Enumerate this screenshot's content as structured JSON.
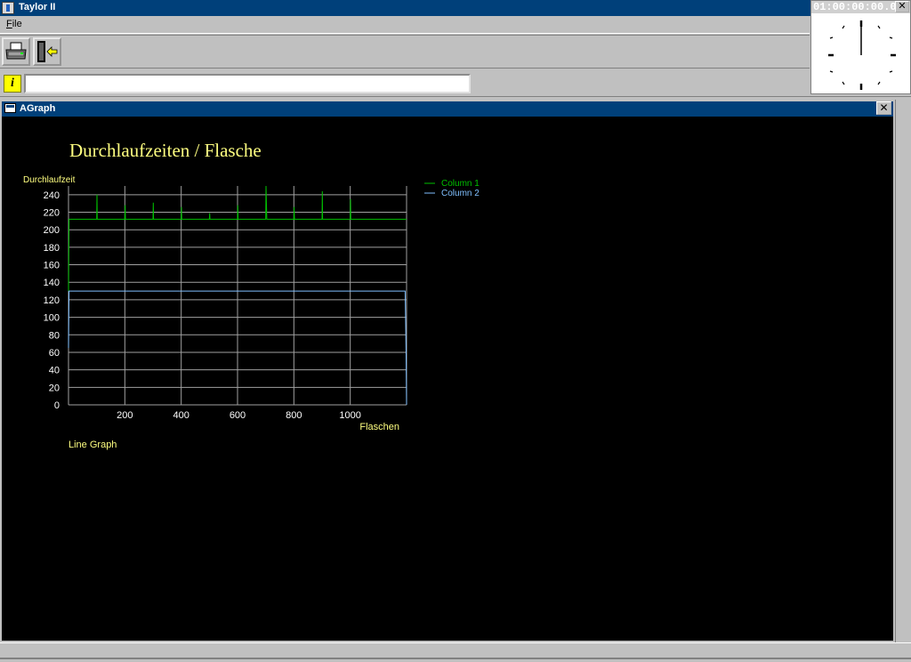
{
  "app": {
    "title": "Taylor II"
  },
  "menu": {
    "file_accel": "F",
    "file_rest": "ile"
  },
  "toolbar": {
    "print_icon": "printer-icon",
    "exit_icon": "exit-door-icon"
  },
  "infobar": {
    "icon": "info-icon",
    "icon_text": "i",
    "value": ""
  },
  "clock": {
    "time": "01:00:00:00.0",
    "close": "✕"
  },
  "window": {
    "title": "AGraph",
    "close": "✕"
  },
  "colors": {
    "titlebar": "#00407a",
    "series1": "#00c000",
    "series2": "#80c0ff",
    "chart_text": "#ffff80"
  },
  "chart_data": {
    "type": "line",
    "title": "Durchlaufzeiten / Flasche",
    "ylabel": "Durchlaufzeit",
    "xlabel": "Flaschen",
    "caption": "Line Graph",
    "xlim": [
      0,
      1200
    ],
    "ylim": [
      0,
      250
    ],
    "xticks": [
      200,
      400,
      600,
      800,
      1000
    ],
    "yticks": [
      0,
      20,
      40,
      60,
      80,
      100,
      120,
      140,
      160,
      180,
      200,
      220,
      240
    ],
    "grid": true,
    "legend_position": "top-right",
    "series": [
      {
        "name": "Column 1",
        "color": "#00c000",
        "points": [
          [
            0,
            130
          ],
          [
            2,
            212
          ],
          [
            100,
            212
          ],
          [
            101,
            240
          ],
          [
            102,
            212
          ],
          [
            200,
            212
          ],
          [
            201,
            228
          ],
          [
            202,
            212
          ],
          [
            300,
            212
          ],
          [
            301,
            231
          ],
          [
            302,
            212
          ],
          [
            400,
            212
          ],
          [
            401,
            226
          ],
          [
            402,
            212
          ],
          [
            500,
            212
          ],
          [
            501,
            219
          ],
          [
            502,
            212
          ],
          [
            600,
            212
          ],
          [
            601,
            228
          ],
          [
            602,
            212
          ],
          [
            700,
            212
          ],
          [
            701,
            250
          ],
          [
            704,
            212
          ],
          [
            800,
            212
          ],
          [
            801,
            226
          ],
          [
            802,
            212
          ],
          [
            900,
            212
          ],
          [
            901,
            244
          ],
          [
            902,
            212
          ],
          [
            1000,
            212
          ],
          [
            1001,
            235
          ],
          [
            1002,
            212
          ],
          [
            1200,
            212
          ]
        ]
      },
      {
        "name": "Column 2",
        "color": "#80c0ff",
        "points": [
          [
            0,
            65
          ],
          [
            2,
            130
          ],
          [
            1195,
            130
          ],
          [
            1198,
            65
          ],
          [
            1200,
            0
          ]
        ]
      }
    ]
  }
}
